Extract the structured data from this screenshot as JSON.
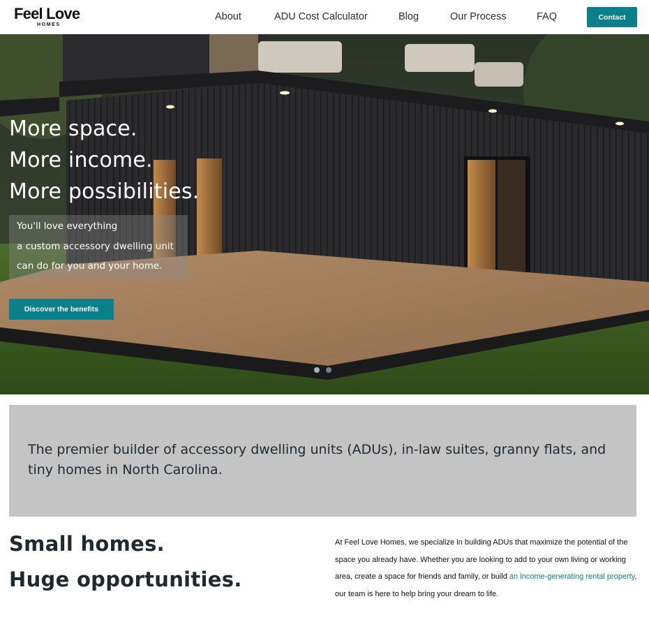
{
  "header": {
    "logo_main": "Feel Love",
    "logo_sub": "HOMES",
    "nav": [
      "About",
      "ADU Cost Calculator",
      "Blog",
      "Our Process",
      "FAQ"
    ],
    "contact_label": "Contact"
  },
  "hero": {
    "title_lines": [
      "More space.",
      "More income.",
      "More possibilities."
    ],
    "subtitle_lines": [
      "You'll love everything",
      "a custom accessory dwelling unit",
      "can do for you and your home."
    ],
    "cta_label": "Discover the benefits",
    "slides": {
      "count": 2,
      "active": 1
    },
    "colors": {
      "accent": "#0b7f8a"
    }
  },
  "banner": {
    "text": "The premier builder of accessory dwelling units (ADUs), in-law suites, granny flats, and tiny homes in North Carolina."
  },
  "intro": {
    "headline_1": "Small homes.",
    "headline_2": "Huge opportunities.",
    "body_before": "At Feel Love Homes, we specialize in building ADUs that maximize the potential of the space you already have. Whether you are looking to add to your own living or working area, create a space for friends and family, or build ",
    "body_link": "an income-generating rental property",
    "body_after": ", our team is here to help bring your dream to life."
  }
}
